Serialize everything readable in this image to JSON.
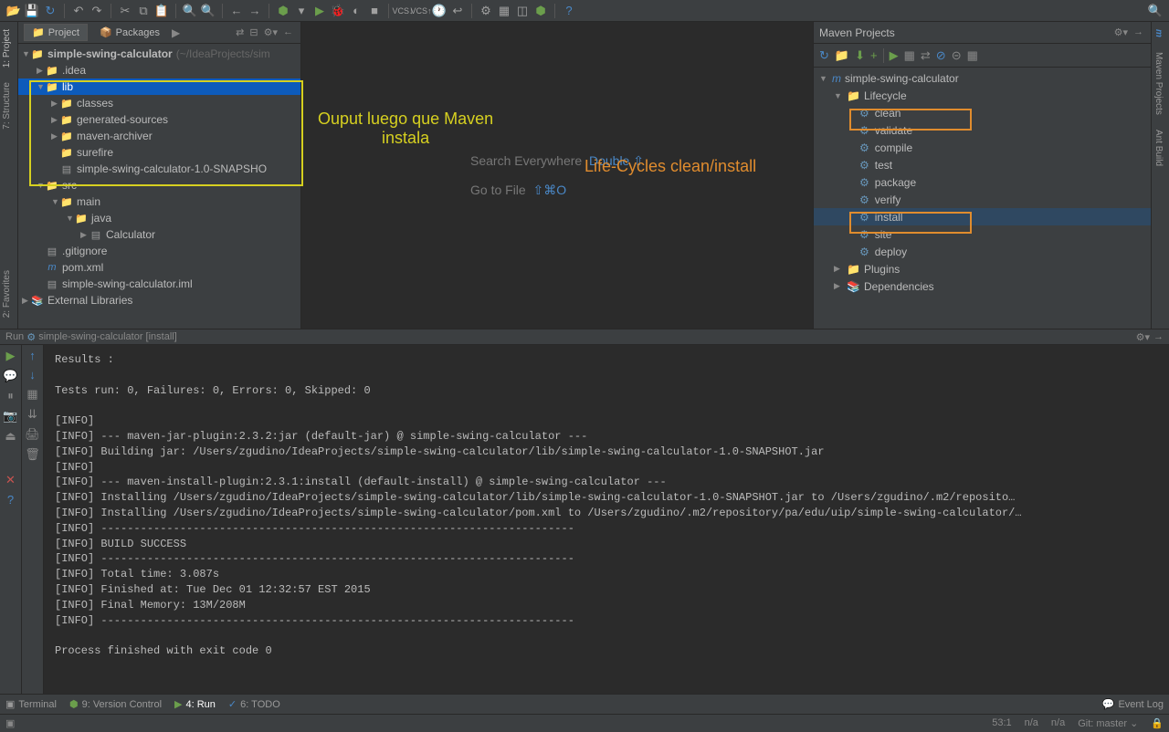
{
  "toolbar_icons": [
    "open",
    "save",
    "sync",
    "undo",
    "redo",
    "cut",
    "copy",
    "paste",
    "find",
    "replace",
    "back",
    "fwd",
    "vcs1",
    "vcs2",
    "run",
    "debug",
    "stop",
    "attach",
    "vcs-up",
    "vcs-dn",
    "settings",
    "structure",
    "help"
  ],
  "project_panel": {
    "tab_project": "Project",
    "tab_packages": "Packages",
    "root": {
      "label": "simple-swing-calculator",
      "path": "(~/IdeaProjects/sim"
    },
    "tree": [
      {
        "indent": 1,
        "arrow": "▶",
        "icon": "folder-orange",
        "label": ".idea"
      },
      {
        "indent": 1,
        "arrow": "▼",
        "icon": "folder-red",
        "label": "lib",
        "selected": true
      },
      {
        "indent": 2,
        "arrow": "▶",
        "icon": "folder-red",
        "label": "classes"
      },
      {
        "indent": 2,
        "arrow": "▶",
        "icon": "folder-red",
        "label": "generated-sources"
      },
      {
        "indent": 2,
        "arrow": "▶",
        "icon": "folder-red",
        "label": "maven-archiver"
      },
      {
        "indent": 2,
        "arrow": "",
        "icon": "folder-red",
        "label": "surefire"
      },
      {
        "indent": 2,
        "arrow": "",
        "icon": "file-gray",
        "label": "simple-swing-calculator-1.0-SNAPSHO"
      },
      {
        "indent": 1,
        "arrow": "▼",
        "icon": "folder-orange",
        "label": "src"
      },
      {
        "indent": 2,
        "arrow": "▼",
        "icon": "folder-blue",
        "label": "main"
      },
      {
        "indent": 3,
        "arrow": "▼",
        "icon": "folder-blue",
        "label": "java"
      },
      {
        "indent": 4,
        "arrow": "▶",
        "icon": "file-gray",
        "label": "Calculator"
      },
      {
        "indent": 1,
        "arrow": "",
        "icon": "file-gray",
        "label": ".gitignore"
      },
      {
        "indent": 1,
        "arrow": "",
        "icon": "file-gray",
        "label": "pom.xml",
        "m": true
      },
      {
        "indent": 1,
        "arrow": "",
        "icon": "file-gray",
        "label": "simple-swing-calculator.iml"
      }
    ],
    "ext_lib": "External Libraries"
  },
  "editor_hints": {
    "search": "Search Everywhere",
    "search_key": "Double ⇧",
    "goto": "Go to File",
    "goto_key": "⇧⌘O"
  },
  "maven": {
    "title": "Maven Projects",
    "root": "simple-swing-calculator",
    "lifecycle": "Lifecycle",
    "goals": [
      "clean",
      "validate",
      "compile",
      "test",
      "package",
      "verify",
      "install",
      "site",
      "deploy"
    ],
    "plugins": "Plugins",
    "deps": "Dependencies"
  },
  "run_header": {
    "label": "Run",
    "config": "simple-swing-calculator [install]"
  },
  "console_text": "Results :\n\nTests run: 0, Failures: 0, Errors: 0, Skipped: 0\n\n[INFO]\n[INFO] --- maven-jar-plugin:2.3.2:jar (default-jar) @ simple-swing-calculator ---\n[INFO] Building jar: /Users/zgudino/IdeaProjects/simple-swing-calculator/lib/simple-swing-calculator-1.0-SNAPSHOT.jar\n[INFO]\n[INFO] --- maven-install-plugin:2.3.1:install (default-install) @ simple-swing-calculator ---\n[INFO] Installing /Users/zgudino/IdeaProjects/simple-swing-calculator/lib/simple-swing-calculator-1.0-SNAPSHOT.jar to /Users/zgudino/.m2/reposito…\n[INFO] Installing /Users/zgudino/IdeaProjects/simple-swing-calculator/pom.xml to /Users/zgudino/.m2/repository/pa/edu/uip/simple-swing-calculator/…\n[INFO] ------------------------------------------------------------------------\n[INFO] BUILD SUCCESS\n[INFO] ------------------------------------------------------------------------\n[INFO] Total time: 3.087s\n[INFO] Finished at: Tue Dec 01 12:32:57 EST 2015\n[INFO] Final Memory: 13M/208M\n[INFO] ------------------------------------------------------------------------\n\nProcess finished with exit code 0",
  "bottom_tabs": {
    "terminal": "Terminal",
    "vcs": "9: Version Control",
    "run": "4: Run",
    "todo": "6: TODO",
    "event_log": "Event Log"
  },
  "status": {
    "pos": "53:1",
    "na1": "n/a",
    "na2": "n/a",
    "git": "Git: master",
    "lock": "🔒"
  },
  "left_tabs": {
    "project": "1: Project",
    "structure": "7: Structure"
  },
  "left_tabs2": {
    "fav": "2: Favorites"
  },
  "right_tabs": {
    "maven": "Maven Projects",
    "ant": "Ant Build"
  },
  "annotations": {
    "yellow_text": "Ouput luego que Maven\ninstala",
    "orange_text": "Life-Cycles clean/install"
  }
}
